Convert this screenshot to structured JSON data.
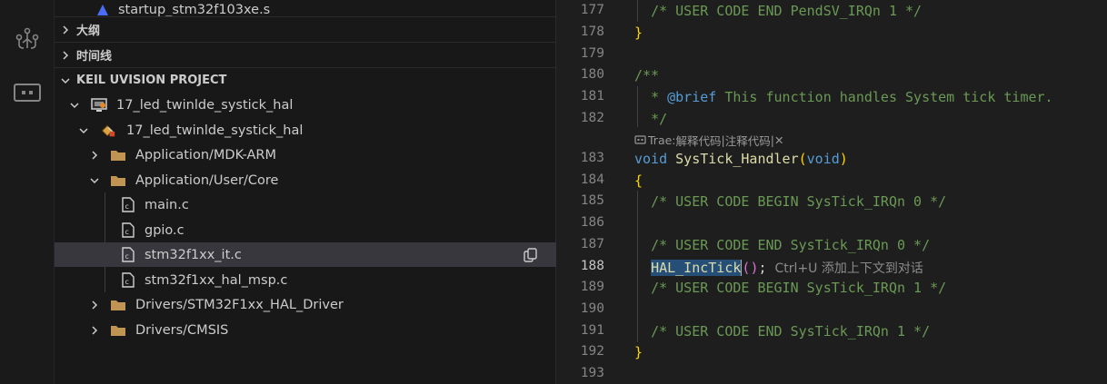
{
  "sidebar": {
    "top_file": "startup_stm32f103xe.s",
    "outline_label": "大纲",
    "timeline_label": "时间线",
    "project_section_label": "KEIL UVISION PROJECT",
    "tree": [
      {
        "label": "17_led_twinlde_systick_hal",
        "icon": "project-icon"
      },
      {
        "label": "17_led_twinlde_systick_hal",
        "icon": "target-icon"
      },
      {
        "label": "Application/MDK-ARM",
        "icon": "folder-icon"
      },
      {
        "label": "Application/User/Core",
        "icon": "folder-icon"
      },
      {
        "label": "main.c",
        "icon": "c-file-icon"
      },
      {
        "label": "gpio.c",
        "icon": "c-file-icon"
      },
      {
        "label": "stm32f1xx_it.c",
        "icon": "c-file-icon"
      },
      {
        "label": "stm32f1xx_hal_msp.c",
        "icon": "c-file-icon"
      },
      {
        "label": "Drivers/STM32F1xx_HAL_Driver",
        "icon": "folder-icon"
      },
      {
        "label": "Drivers/CMSIS",
        "icon": "folder-icon"
      }
    ]
  },
  "editor": {
    "lines": {
      "l177": {
        "num": "177",
        "text": "/* USER CODE END PendSV_IRQn 1 */"
      },
      "l178": {
        "num": "178",
        "text": "}"
      },
      "l179": {
        "num": "179"
      },
      "l180": {
        "num": "180",
        "text": "/**"
      },
      "l181": {
        "num": "181",
        "star": "* ",
        "tag": "@brief",
        "rest": " This function handles System tick timer."
      },
      "l182": {
        "num": "182",
        "text": "*/"
      },
      "l183": {
        "num": "183",
        "kw1": "void",
        "fn": "SysTick_Handler",
        "kw2": "void"
      },
      "l184": {
        "num": "184",
        "text": "{"
      },
      "l185": {
        "num": "185",
        "text": "/* USER CODE BEGIN SysTick_IRQn 0 */"
      },
      "l186": {
        "num": "186"
      },
      "l187": {
        "num": "187",
        "text": "/* USER CODE END SysTick_IRQn 0 */"
      },
      "l188": {
        "num": "188",
        "fn": "HAL_IncTick",
        "paren_open": "(",
        "paren_close": ")",
        "semi": ";",
        "hint": "Ctrl+U 添加上下文到对话"
      },
      "l189": {
        "num": "189",
        "text": "/* USER CODE BEGIN SysTick_IRQn 1 */"
      },
      "l190": {
        "num": "190"
      },
      "l191": {
        "num": "191",
        "text": "/* USER CODE END SysTick_IRQn 1 */"
      },
      "l192": {
        "num": "192",
        "text": "}"
      },
      "l193": {
        "num": "193"
      }
    },
    "codelens": {
      "prefix": "Trae: ",
      "explain": "解释代码",
      "sep1": " | ",
      "comment": "注释代码",
      "sep2": " | ",
      "close": "✕"
    }
  },
  "colors": {
    "comment": "#6a9955",
    "keyword": "#569cd6",
    "function": "#dcdcaa",
    "selection": "#37373d",
    "folder": "#c09553"
  }
}
